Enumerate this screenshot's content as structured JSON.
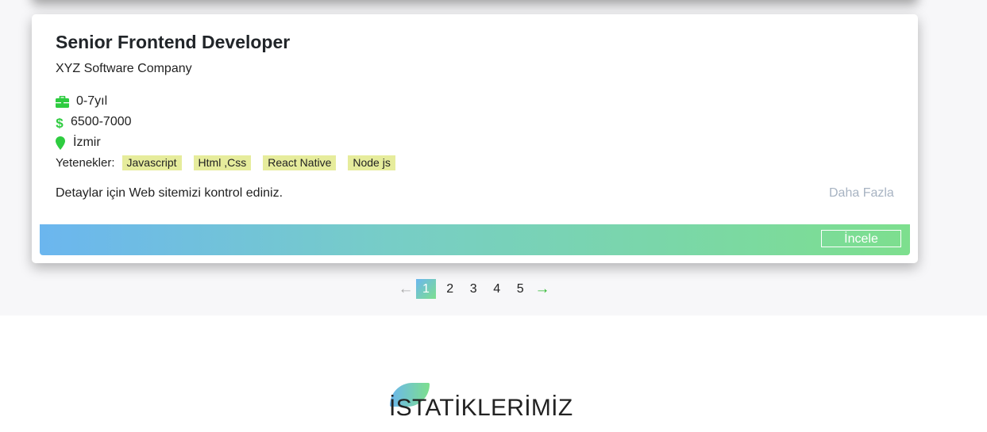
{
  "job": {
    "title": "Senior Frontend Developer",
    "company": "XYZ Software Company",
    "experience": "0-7yıl",
    "salary": "6500-7000",
    "location": "İzmir",
    "skills_label": "Yetenekler:",
    "skills": [
      "Javascript",
      "Html ,Css",
      "React Native",
      "Node js"
    ],
    "description": "Detaylar için Web sitemizi kontrol ediniz.",
    "more_link": "Daha Fazla",
    "action_button": "İncele"
  },
  "pagination": {
    "prev": "←",
    "next": "→",
    "pages": [
      "1",
      "2",
      "3",
      "4",
      "5"
    ],
    "active_page": "1"
  },
  "stats": {
    "title": "İSTATİKLERİMİZ"
  },
  "icons": {
    "experience": "briefcase-icon",
    "salary": "dollar-icon",
    "location": "map-marker-icon"
  },
  "colors": {
    "icon_green": "#2ecc40",
    "gradient_start": "#6bb6ef",
    "gradient_end": "#7ddf8e",
    "skill_tag_bg": "#e6ec9c",
    "muted_link": "#a7b3c2"
  }
}
